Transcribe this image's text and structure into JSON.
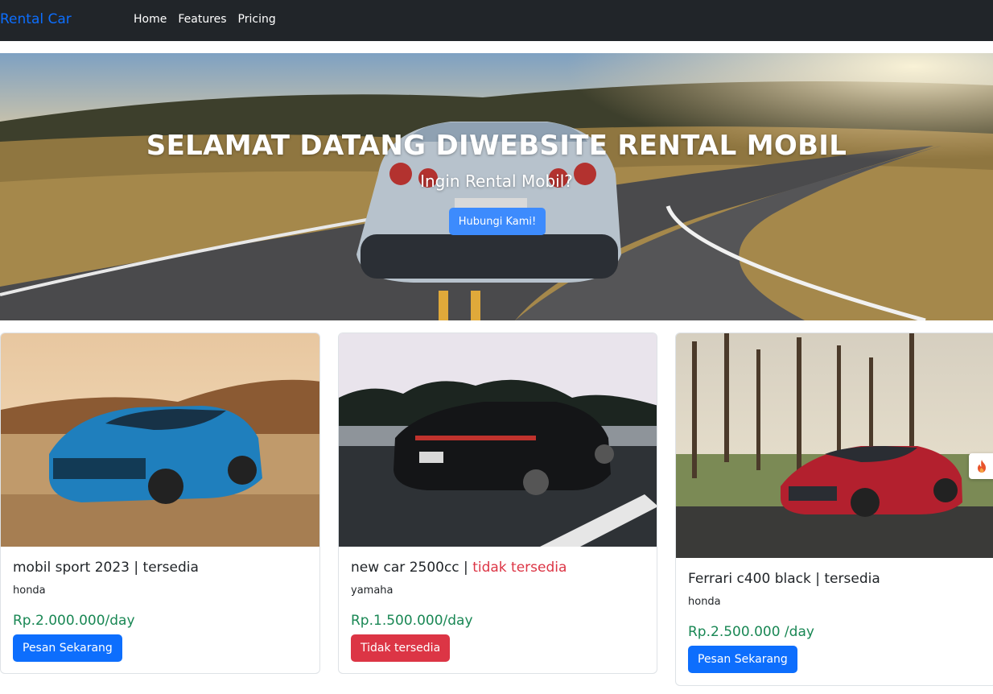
{
  "navbar": {
    "brand": "Rental Car",
    "links": [
      "Home",
      "Features",
      "Pricing"
    ]
  },
  "hero": {
    "title": "SELAMAT DATANG DIWEBSITE RENTAL MOBIL",
    "subtitle": "Ingin Rental Mobil?",
    "button": "Hubungi Kami!"
  },
  "cards": [
    {
      "title_name": "mobil sport 2023",
      "separator": " | ",
      "status": "tersedia",
      "brand": "honda",
      "price": "Rp.2.000.000/day",
      "button": "Pesan Sekarang"
    },
    {
      "title_name": "new car 2500cc",
      "separator": " | ",
      "status": "tidak tersedia",
      "brand": "yamaha",
      "price": "Rp.1.500.000/day",
      "button": "Tidak tersedia"
    },
    {
      "title_name": "Ferrari c400 black",
      "separator": " | ",
      "status": "tersedia",
      "brand": "honda",
      "price": "Rp.2.500.000 /day",
      "button": "Pesan Sekarang"
    }
  ],
  "icons": {
    "floating_badge": "fire-icon"
  },
  "colors": {
    "navbar_bg": "#212529",
    "brand": "#0d6efd",
    "primary": "#0d6efd",
    "danger": "#dc3545",
    "price": "#198754"
  }
}
